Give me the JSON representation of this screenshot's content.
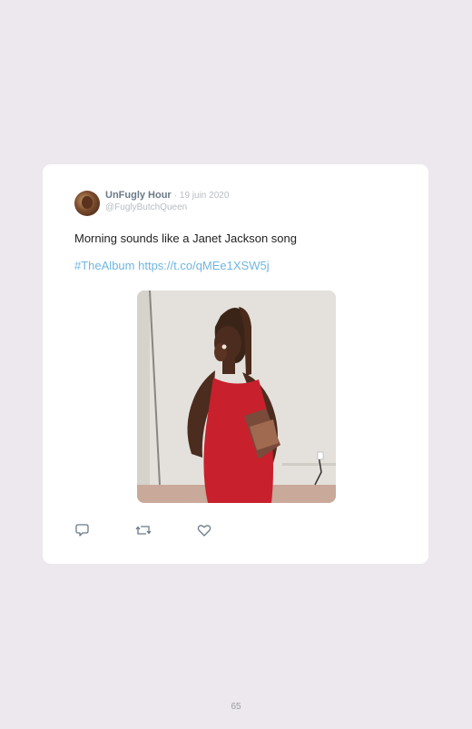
{
  "tweet": {
    "author_name": "UnFugly Hour",
    "date": "· 19 juin 2020",
    "handle": "@FuglyButchQueen",
    "text": "Morning sounds like a Janet Jackson song",
    "hashtag": "#TheAlbum",
    "link": "https://t.co/qMEe1XSW5j",
    "media_icon": "embedded-gif-photo"
  },
  "actions": {
    "reply_icon": "reply-icon",
    "retweet_icon": "retweet-icon",
    "like_icon": "heart-icon"
  },
  "page": {
    "number": "65"
  }
}
